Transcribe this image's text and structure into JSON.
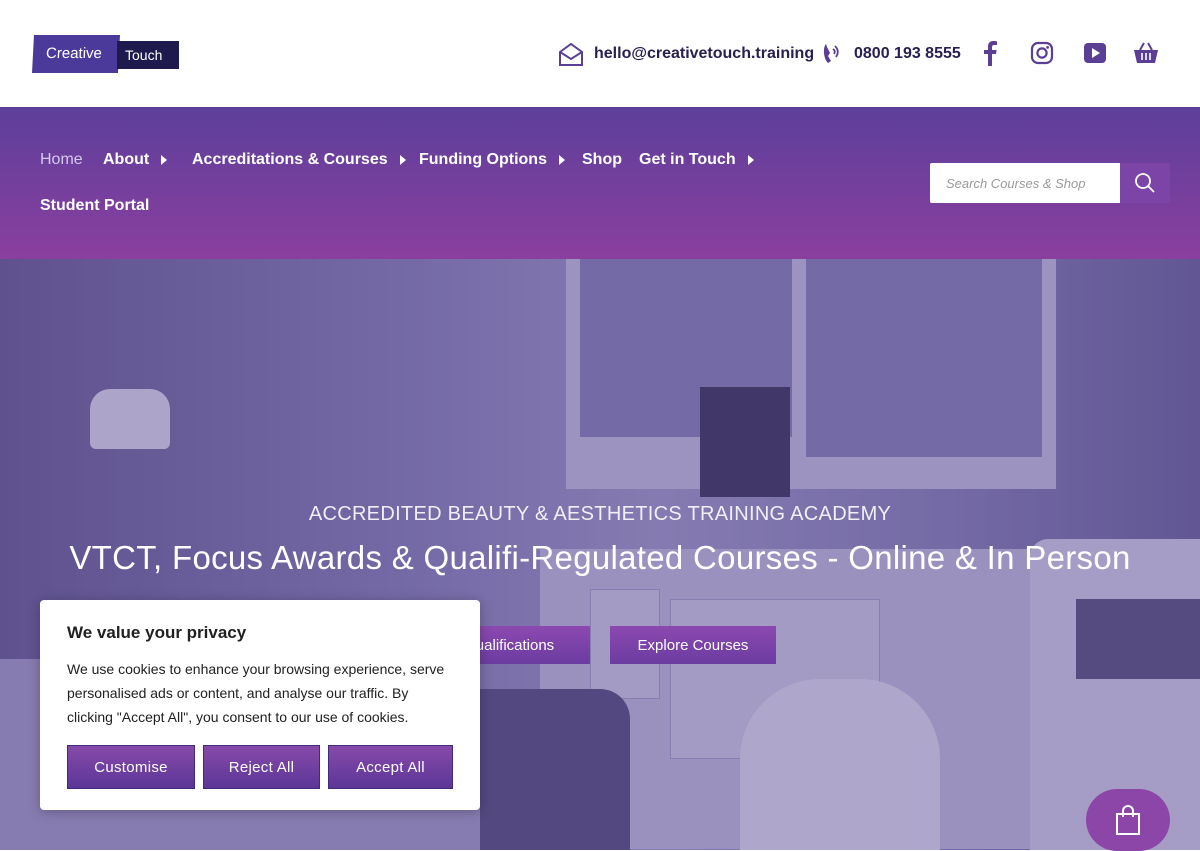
{
  "logo": {
    "word1": "Creative",
    "word2": "Touch"
  },
  "contact": {
    "email": "hello@creativetouch.training",
    "phone": "0800 193 8555"
  },
  "social": [
    "facebook-icon",
    "instagram-icon",
    "youtube-icon",
    "basket-icon"
  ],
  "nav": {
    "items": [
      {
        "label": "Home"
      },
      {
        "label": "About"
      },
      {
        "label": "Accreditations & Courses"
      },
      {
        "label": "Funding Options"
      },
      {
        "label": "Shop"
      },
      {
        "label": "Get in Touch"
      },
      {
        "label": "Student Portal"
      }
    ],
    "search_placeholder": "Search Courses & Shop"
  },
  "hero": {
    "subtitle": "ACCREDITED BEAUTY & AESTHETICS TRAINING ACADEMY",
    "title": "VTCT, Focus Awards & Qualifi-Regulated Courses - Online & In Person",
    "button1": "ualifications",
    "button2": "Explore Courses"
  },
  "cookie": {
    "title": "We value your privacy",
    "text": "We use cookies to enhance your browsing experience, serve personalised ads or content, and analyse our traffic. By clicking \"Accept All\", you consent to our use of cookies.",
    "customise": "Customise",
    "reject": "Reject All",
    "accept": "Accept All"
  },
  "colors": {
    "brand": "#6a3fa0",
    "nav_gradient_top": "#5d3f9b",
    "nav_gradient_bottom": "#8a3f9e",
    "text_dark": "#2a2050"
  }
}
